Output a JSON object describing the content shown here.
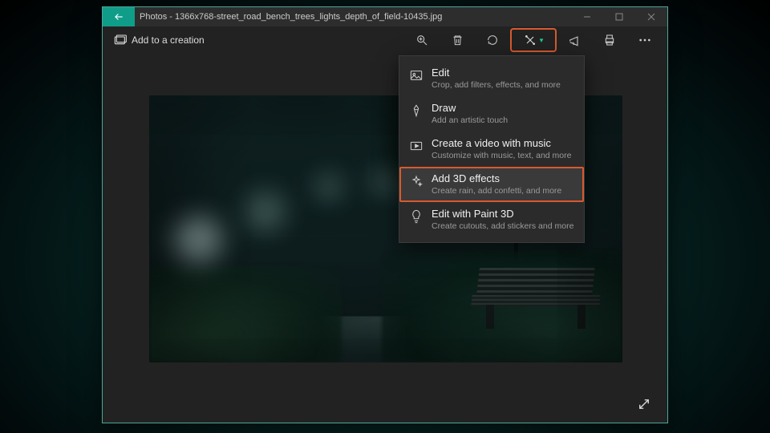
{
  "titlebar": {
    "app": "Photos",
    "separator": " - ",
    "file": "1366x768-street_road_bench_trees_lights_depth_of_field-10435.jpg"
  },
  "toolbar": {
    "add_to_creation": "Add to a creation"
  },
  "menu": {
    "items": [
      {
        "icon": "image-icon",
        "title": "Edit",
        "sub": "Crop, add filters, effects, and more"
      },
      {
        "icon": "pen-icon",
        "title": "Draw",
        "sub": "Add an artistic touch"
      },
      {
        "icon": "video-icon",
        "title": "Create a video with music",
        "sub": "Customize with music, text, and more"
      },
      {
        "icon": "sparkle-icon",
        "title": "Add 3D effects",
        "sub": "Create rain, add confetti, and more"
      },
      {
        "icon": "bulb-icon",
        "title": "Edit with Paint 3D",
        "sub": "Create cutouts, add stickers and more"
      }
    ],
    "highlight_index": 3
  },
  "colors": {
    "accent": "#0f9d8a",
    "annotation": "#d75a2f"
  }
}
